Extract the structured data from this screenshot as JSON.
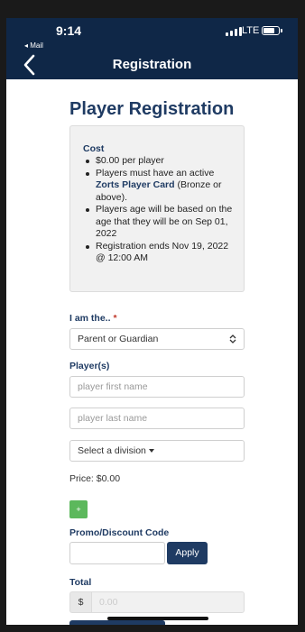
{
  "status_bar": {
    "time": "9:14",
    "back_app": "◂ Mail",
    "network": "LTE"
  },
  "nav": {
    "title": "Registration",
    "back_icon": "chevron-left-icon"
  },
  "page": {
    "title": "Player Registration"
  },
  "info": {
    "cost_label": "Cost",
    "items": {
      "price": "$0.00 per player",
      "card_before": "Players must have an active ",
      "card_link": "Zorts Player Card",
      "card_after": " (Bronze or above).",
      "age": "Players age will be based on the age that they will be on Sep 01, 2022",
      "ends": "Registration ends Nov 19, 2022 @ 12:00 AM"
    }
  },
  "form": {
    "role_label": "I am the..",
    "required_marker": "*",
    "role_value": "Parent or Guardian",
    "players_label": "Player(s)",
    "first_name_placeholder": "player first name",
    "last_name_placeholder": "player last name",
    "division_label": "Select a division",
    "price_text": "Price: $0.00",
    "add_label": "+",
    "promo_label": "Promo/Discount Code",
    "apply_label": "Apply",
    "total_label": "Total",
    "currency": "$",
    "total_placeholder": "0.00"
  },
  "colors": {
    "header": "#0f2747",
    "accent": "#1f3b63",
    "add_button": "#5cb85c"
  }
}
